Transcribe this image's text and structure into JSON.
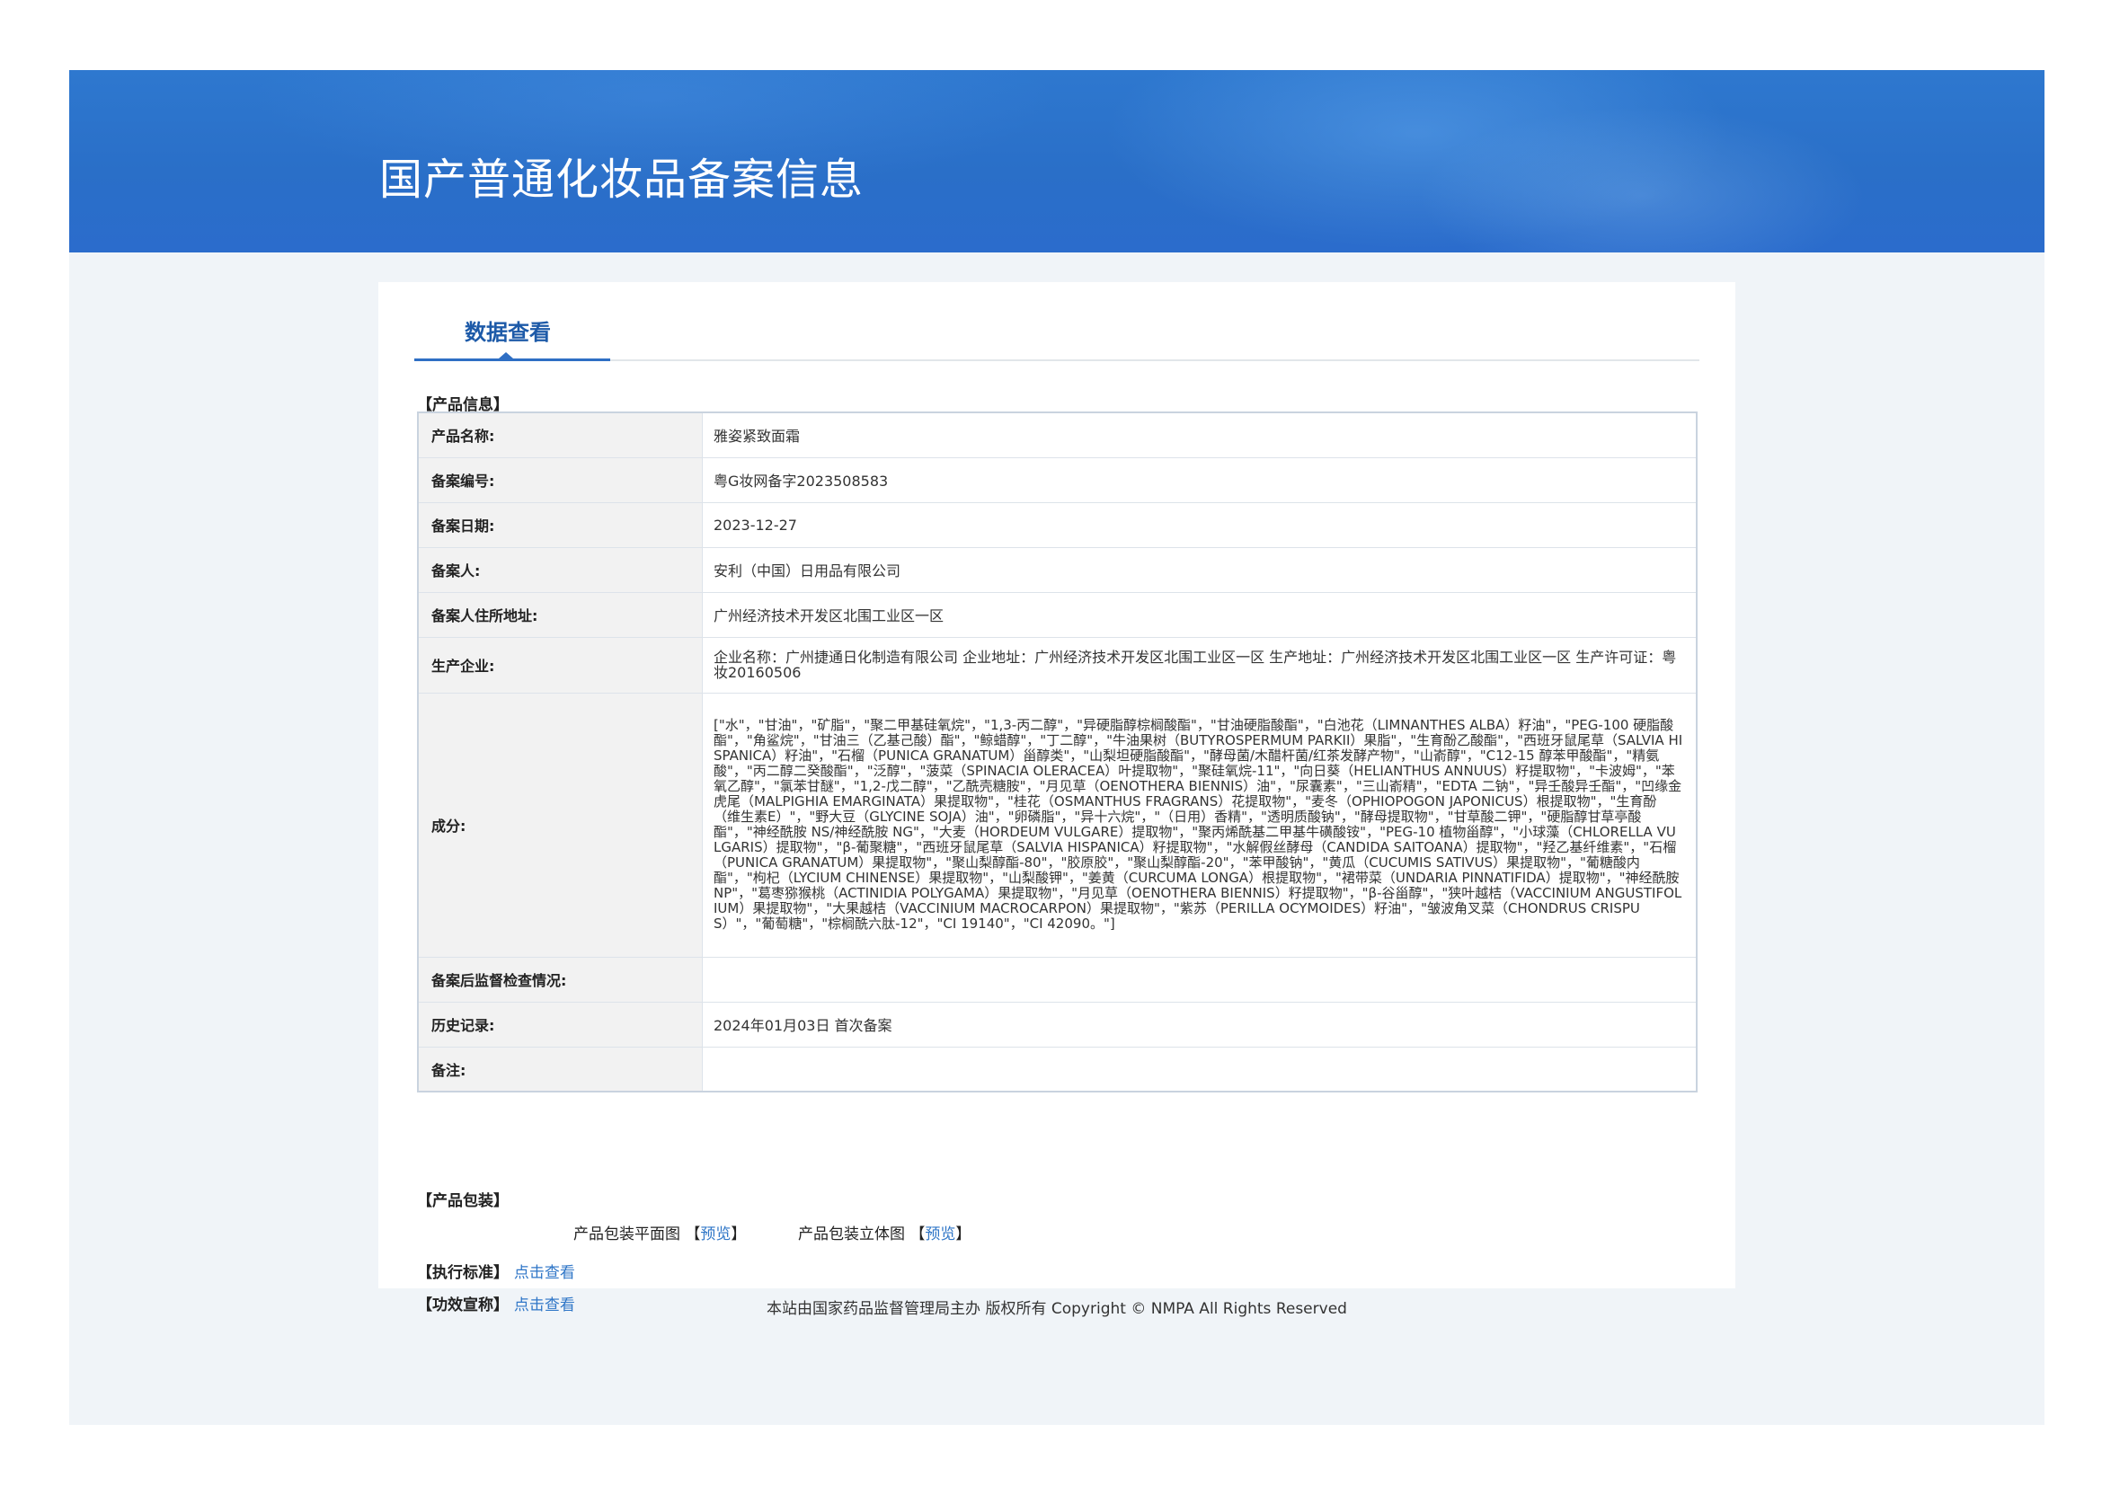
{
  "header": {
    "title": "国产普通化妆品备案信息"
  },
  "tabs": [
    {
      "label": "数据查看",
      "active": true
    }
  ],
  "product_info": {
    "section_label": "【产品信息】",
    "rows": [
      {
        "key": "产品名称:",
        "value": "雅姿紧致面霜"
      },
      {
        "key": "备案编号:",
        "value": "粤G妆网备字2023508583"
      },
      {
        "key": "备案日期:",
        "value": "2023-12-27"
      },
      {
        "key": "备案人:",
        "value": "安利（中国）日用品有限公司"
      },
      {
        "key": "备案人住所地址:",
        "value": "广州经济技术开发区北围工业区一区"
      },
      {
        "key": "生产企业:",
        "value": "企业名称：广州捷通日化制造有限公司 企业地址：广州经济技术开发区北围工业区一区 生产地址：广州经济技术开发区北围工业区一区 生产许可证：粤妆20160506"
      },
      {
        "key": "成分:",
        "value": "[\"水\"，\"甘油\"，\"矿脂\"，\"聚二甲基硅氧烷\"，\"1,3-丙二醇\"，\"异硬脂醇棕榈酸酯\"，\"甘油硬脂酸酯\"，\"白池花（LIMNANTHES ALBA）籽油\"，\"PEG-100 硬脂酸酯\"，\"角鲨烷\"，\"甘油三（乙基己酸）酯\"，\"鲸蜡醇\"，\"丁二醇\"，\"牛油果树（BUTYROSPERMUM PARKII）果脂\"，\"生育酚乙酸酯\"，\"西班牙鼠尾草（SALVIA HISPANICA）籽油\"，\"石榴（PUNICA GRANATUM）甾醇类\"，\"山梨坦硬脂酸酯\"，\"酵母菌/木醋杆菌/红茶发酵产物\"，\"山嵛醇\"，\"C12-15 醇苯甲酸酯\"，\"精氨酸\"，\"丙二醇二癸酸酯\"，\"泛醇\"，\"菠菜（SPINACIA OLERACEA）叶提取物\"，\"聚硅氧烷-11\"，\"向日葵（HELIANTHUS ANNUUS）籽提取物\"，\"卡波姆\"，\"苯氧乙醇\"，\"氯苯甘醚\"，\"1,2-戊二醇\"，\"乙酰壳糖胺\"，\"月见草（OENOTHERA BIENNIS）油\"，\"尿囊素\"，\"三山嵛精\"，\"EDTA 二钠\"，\"异壬酸异壬酯\"，\"凹缘金虎尾（MALPIGHIA EMARGINATA）果提取物\"，\"桂花（OSMANTHUS FRAGRANS）花提取物\"，\"麦冬（OPHIOPOGON JAPONICUS）根提取物\"，\"生育酚（维生素E）\"，\"野大豆（GLYCINE SOJA）油\"，\"卵磷脂\"，\"异十六烷\"，\"（日用）香精\"，\"透明质酸钠\"，\"酵母提取物\"，\"甘草酸二钾\"，\"硬脂醇甘草亭酸酯\"，\"神经酰胺 NS/神经酰胺 NG\"，\"大麦（HORDEUM VULGARE）提取物\"，\"聚丙烯酰基二甲基牛磺酸铵\"，\"PEG-10 植物甾醇\"，\"小球藻（CHLORELLA VULGARIS）提取物\"，\"β-葡聚糖\"，\"西班牙鼠尾草（SALVIA HISPANICA）籽提取物\"，\"水解假丝酵母（CANDIDA SAITOANA）提取物\"，\"羟乙基纤维素\"，\"石榴（PUNICA GRANATUM）果提取物\"，\"聚山梨醇酯-80\"，\"胶原胶\"，\"聚山梨醇酯-20\"，\"苯甲酸钠\"，\"黄瓜（CUCUMIS SATIVUS）果提取物\"，\"葡糖酸内酯\"，\"枸杞（LYCIUM CHINENSE）果提取物\"，\"山梨酸钾\"，\"姜黄（CURCUMA LONGA）根提取物\"，\"裙带菜（UNDARIA PINNATIFIDA）提取物\"，\"神经酰胺 NP\"，\"葛枣猕猴桃（ACTINIDIA POLYGAMA）果提取物\"，\"月见草（OENOTHERA BIENNIS）籽提取物\"，\"β-谷甾醇\"，\"狭叶越桔（VACCINIUM ANGUSTIFOLIUM）果提取物\"，\"大果越桔（VACCINIUM MACROCARPON）果提取物\"，\"紫苏（PERILLA OCYMOIDES）籽油\"，\"皱波角叉菜（CHONDRUS CRISPUS）\"，\"葡萄糖\"，\"棕榈酰六肽-12\"，\"CI 19140\"，\"CI 42090。\"]"
      },
      {
        "key": "备案后监督检查情况:",
        "value": ""
      },
      {
        "key": "历史记录:",
        "value": "2024年01月03日 首次备案"
      },
      {
        "key": "备注:",
        "value": ""
      }
    ]
  },
  "packaging": {
    "section_label": "【产品包装】",
    "flat_label": "产品包装平面图",
    "solid_label": "产品包装立体图",
    "bracket_open": "【",
    "bracket_close": "】",
    "preview_label": "预览"
  },
  "standard": {
    "label": "【执行标准】",
    "link": "点击查看"
  },
  "efficacy": {
    "label": "【功效宣称】",
    "link": "点击查看"
  },
  "footer": {
    "text": "本站由国家药品监督管理局主办 版权所有 Copyright © NMPA All Rights Reserved"
  }
}
